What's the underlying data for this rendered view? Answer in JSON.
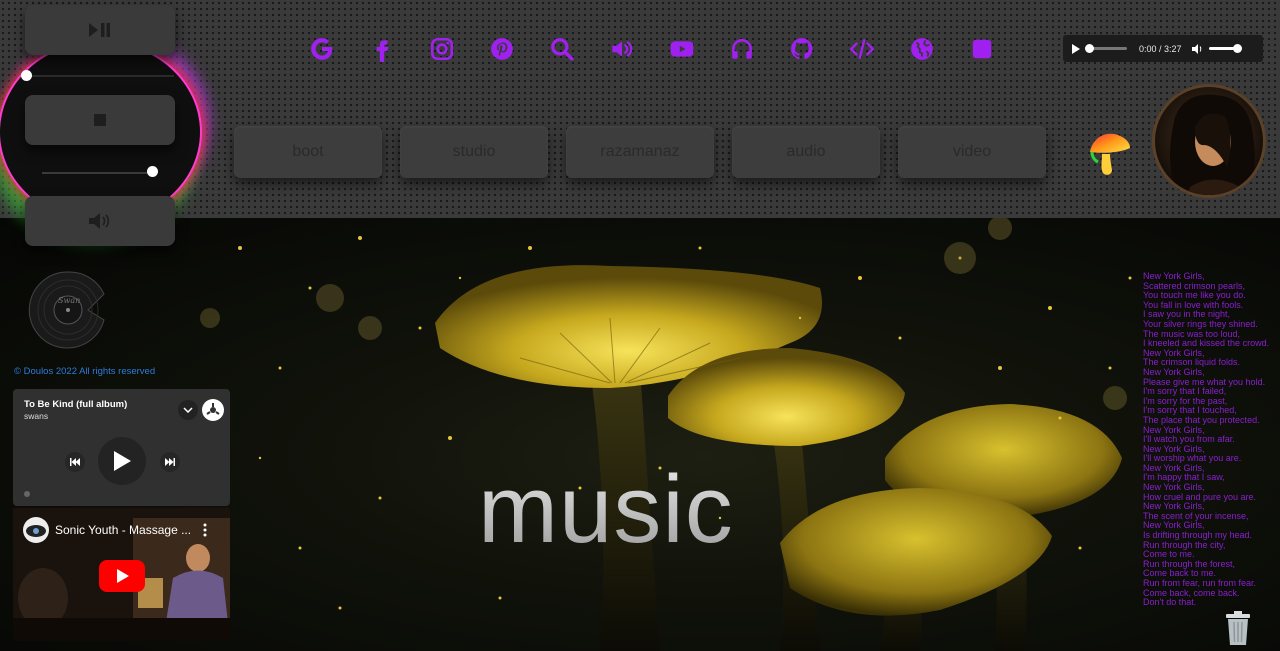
{
  "nav": [
    {
      "label": "boot"
    },
    {
      "label": "studio"
    },
    {
      "label": "razamanaz"
    },
    {
      "label": "audio"
    },
    {
      "label": "video"
    }
  ],
  "social_icons": [
    "google-icon",
    "facebook-icon",
    "instagram-icon",
    "pinterest-icon",
    "search-icon",
    "speaker-icon",
    "youtube-icon",
    "headphones-icon",
    "github-icon",
    "code-icon",
    "globe-icon",
    "square-icon"
  ],
  "colors": {
    "accent": "#a020f0",
    "lyrics": "#8a1fd0",
    "copyright": "#2e7bd9",
    "youtube_red": "#ff0000"
  },
  "audio_player": {
    "time": "0:00 / 3:27",
    "progress": 0,
    "volume": 1.0
  },
  "left_control": {
    "play_pause_icon": "play-pause-icon",
    "stop_icon": "stop-icon",
    "volume_icon": "speaker-icon",
    "top_slider": 0,
    "bottom_slider": 1.0
  },
  "copyright": "© Doulos 2022 All rights reserved",
  "soundcloud": {
    "title": "To Be Kind (full album)",
    "artist": "swans"
  },
  "youtube": {
    "title": "Sonic Youth - Massage ..."
  },
  "page_title": "music",
  "lyrics": [
    "New York Girls,",
    "Scattered crimson pearls,",
    "You touch me like you do.",
    "You fall in love with fools.",
    "I saw you in the night,",
    "Your silver rings they shined.",
    "The music was too loud,",
    "I kneeled and kissed the crowd.",
    "New York Girls,",
    "The crimson liquid folds.",
    "New York Girls,",
    "Please give me what you hold.",
    "I'm sorry that I failed,",
    "I'm sorry for the past,",
    "I'm sorry that I touched,",
    "The place that you protected.",
    "New York Girls,",
    "I'll watch you from afar.",
    "New York Girls,",
    "I'll worship what you are.",
    "New York Girls,",
    "I'm happy that I saw,",
    "New York Girls,",
    "How cruel and pure you are.",
    "New York Girls,",
    "The scent of your incense,",
    "New York Girls,",
    "Is drifting through my head.",
    "Run through the city,",
    "Come to me.",
    "Run through the forest,",
    "Come back to me.",
    "Run from fear, run from fear.",
    "Come back, come back.",
    "Don't do that."
  ]
}
